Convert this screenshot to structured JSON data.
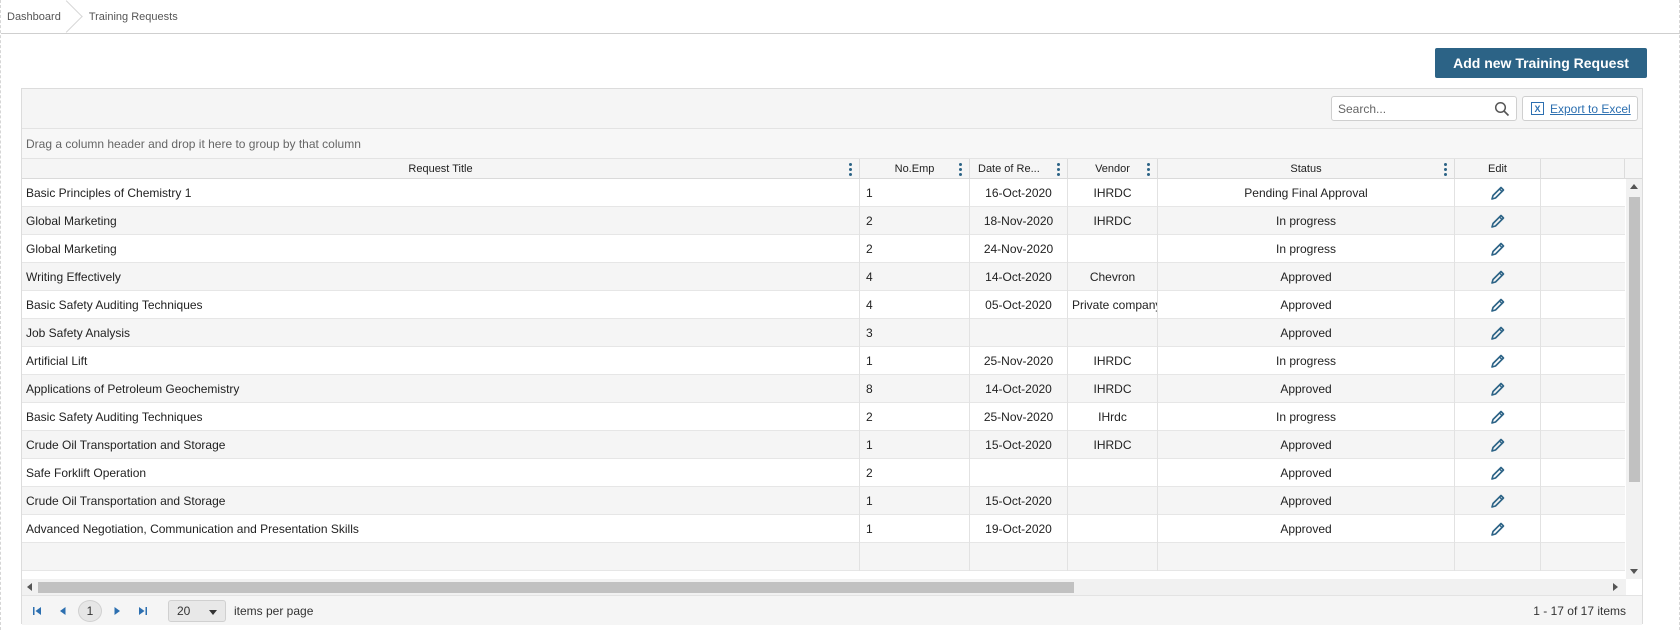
{
  "breadcrumb": {
    "items": [
      "Dashboard",
      "Training Requests"
    ]
  },
  "actions": {
    "add_label": "Add new Training Request"
  },
  "toolbar": {
    "search_placeholder": "Search...",
    "export_label": "Export to Excel"
  },
  "group_panel": {
    "hint": "Drag a column header and drop it here to group by that column"
  },
  "columns": {
    "title": "Request Title",
    "emp": "No.Emp",
    "date": "Date of Re...",
    "vendor": "Vendor",
    "status": "Status",
    "edit": "Edit"
  },
  "rows": [
    {
      "title": "Basic Principles of Chemistry 1",
      "emp": "1",
      "date": "16-Oct-2020",
      "vendor": "IHRDC",
      "status": "Pending Final Approval"
    },
    {
      "title": "Global Marketing",
      "emp": "2",
      "date": "18-Nov-2020",
      "vendor": "IHRDC",
      "status": "In progress"
    },
    {
      "title": "Global Marketing",
      "emp": "2",
      "date": "24-Nov-2020",
      "vendor": "",
      "status": "In progress"
    },
    {
      "title": "Writing Effectively",
      "emp": "4",
      "date": "14-Oct-2020",
      "vendor": "Chevron",
      "status": "Approved"
    },
    {
      "title": "Basic Safety Auditing Techniques",
      "emp": "4",
      "date": "05-Oct-2020",
      "vendor": "Private company",
      "status": "Approved"
    },
    {
      "title": "Job Safety Analysis",
      "emp": "3",
      "date": "",
      "vendor": "",
      "status": "Approved"
    },
    {
      "title": "Artificial Lift",
      "emp": "1",
      "date": "25-Nov-2020",
      "vendor": "IHRDC",
      "status": "In progress"
    },
    {
      "title": "Applications of Petroleum Geochemistry",
      "emp": "8",
      "date": "14-Oct-2020",
      "vendor": "IHRDC",
      "status": "Approved"
    },
    {
      "title": "Basic Safety Auditing Techniques",
      "emp": "2",
      "date": "25-Nov-2020",
      "vendor": "IHrdc",
      "status": "In progress"
    },
    {
      "title": "Crude Oil Transportation and Storage",
      "emp": "1",
      "date": "15-Oct-2020",
      "vendor": "IHRDC",
      "status": "Approved"
    },
    {
      "title": "Safe Forklift Operation",
      "emp": "2",
      "date": "",
      "vendor": "",
      "status": "Approved"
    },
    {
      "title": "Crude Oil Transportation and Storage",
      "emp": "1",
      "date": "15-Oct-2020",
      "vendor": "",
      "status": "Approved"
    },
    {
      "title": "Advanced Negotiation, Communication and Presentation Skills",
      "emp": "1",
      "date": "19-Oct-2020",
      "vendor": "",
      "status": "Approved"
    }
  ],
  "pager": {
    "current_page": "1",
    "page_size": "20",
    "items_per_page_label": "items per page",
    "info": "1 - 17 of 17 items"
  },
  "colors": {
    "primary": "#2c6386",
    "link": "#2c6fb0"
  },
  "icons": {
    "edit": "pencil-icon",
    "search": "magnifier-icon",
    "export": "excel-icon",
    "column_menu": "vertical-dots-icon"
  }
}
